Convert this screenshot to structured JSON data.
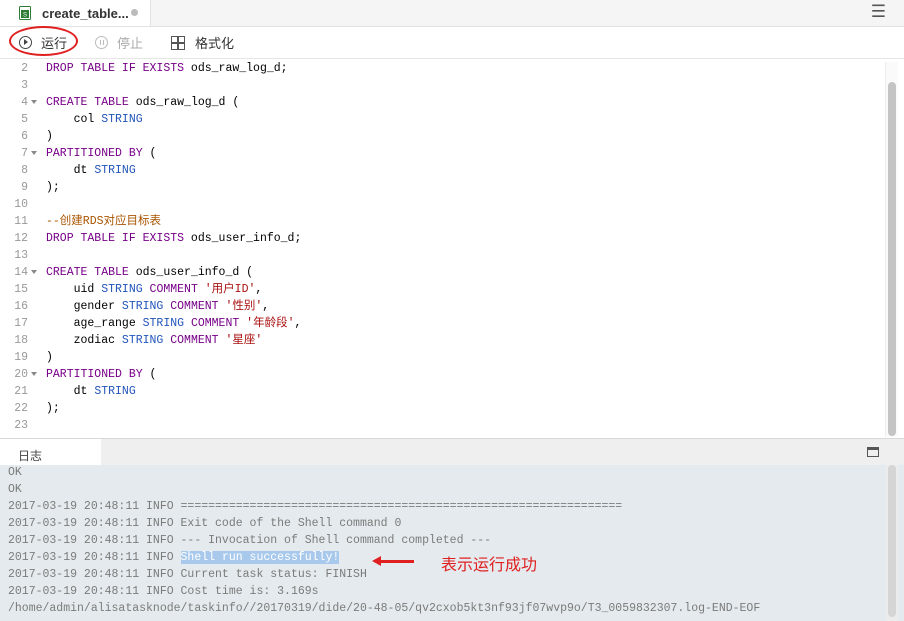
{
  "tab": {
    "title": "create_table..."
  },
  "toolbar": {
    "run_label": "运行",
    "stop_label": "停止",
    "format_label": "格式化"
  },
  "editor": {
    "lines": [
      {
        "n": "2",
        "fold": false,
        "tokens": [
          [
            "kw",
            "DROP TABLE IF EXISTS"
          ],
          [
            "",
            "ods_raw_log_d;"
          ]
        ]
      },
      {
        "n": "3",
        "fold": false,
        "tokens": []
      },
      {
        "n": "4",
        "fold": true,
        "tokens": [
          [
            "kw",
            "CREATE TABLE"
          ],
          [
            "",
            "ods_raw_log_d ("
          ]
        ]
      },
      {
        "n": "5",
        "fold": false,
        "tokens": [
          [
            "",
            "    col "
          ],
          [
            "ty",
            "STRING"
          ]
        ]
      },
      {
        "n": "6",
        "fold": false,
        "tokens": [
          [
            "",
            ")"
          ]
        ]
      },
      {
        "n": "7",
        "fold": true,
        "tokens": [
          [
            "kw",
            "PARTITIONED BY"
          ],
          [
            "",
            " ("
          ]
        ]
      },
      {
        "n": "8",
        "fold": false,
        "tokens": [
          [
            "",
            "    dt "
          ],
          [
            "ty",
            "STRING"
          ]
        ]
      },
      {
        "n": "9",
        "fold": false,
        "tokens": [
          [
            "",
            ");"
          ]
        ]
      },
      {
        "n": "10",
        "fold": false,
        "tokens": []
      },
      {
        "n": "11",
        "fold": false,
        "tokens": [
          [
            "cm",
            "--创建RDS对应目标表"
          ]
        ]
      },
      {
        "n": "12",
        "fold": false,
        "tokens": [
          [
            "kw",
            "DROP TABLE IF EXISTS"
          ],
          [
            "",
            " ods_user_info_d;"
          ]
        ]
      },
      {
        "n": "13",
        "fold": false,
        "tokens": []
      },
      {
        "n": "14",
        "fold": true,
        "tokens": [
          [
            "kw",
            "CREATE TABLE"
          ],
          [
            "",
            " ods_user_info_d ("
          ]
        ]
      },
      {
        "n": "15",
        "fold": false,
        "tokens": [
          [
            "",
            "    uid "
          ],
          [
            "ty",
            "STRING"
          ],
          [
            "",
            " "
          ],
          [
            "kw",
            "COMMENT"
          ],
          [
            "",
            " "
          ],
          [
            "str",
            "'用户ID'"
          ],
          [
            "",
            ","
          ]
        ]
      },
      {
        "n": "16",
        "fold": false,
        "tokens": [
          [
            "",
            "    gender "
          ],
          [
            "ty",
            "STRING"
          ],
          [
            "",
            " "
          ],
          [
            "kw",
            "COMMENT"
          ],
          [
            "",
            " "
          ],
          [
            "str",
            "'性别'"
          ],
          [
            "",
            ","
          ]
        ]
      },
      {
        "n": "17",
        "fold": false,
        "tokens": [
          [
            "",
            "    age_range "
          ],
          [
            "ty",
            "STRING"
          ],
          [
            "",
            " "
          ],
          [
            "kw",
            "COMMENT"
          ],
          [
            "",
            " "
          ],
          [
            "str",
            "'年龄段'"
          ],
          [
            "",
            ","
          ]
        ]
      },
      {
        "n": "18",
        "fold": false,
        "tokens": [
          [
            "",
            "    zodiac "
          ],
          [
            "ty",
            "STRING"
          ],
          [
            "",
            " "
          ],
          [
            "kw",
            "COMMENT"
          ],
          [
            "",
            " "
          ],
          [
            "str",
            "'星座'"
          ]
        ]
      },
      {
        "n": "19",
        "fold": false,
        "tokens": [
          [
            "",
            ")"
          ]
        ]
      },
      {
        "n": "20",
        "fold": true,
        "tokens": [
          [
            "kw",
            "PARTITIONED BY"
          ],
          [
            "",
            " ("
          ]
        ]
      },
      {
        "n": "21",
        "fold": false,
        "tokens": [
          [
            "",
            "    dt "
          ],
          [
            "ty",
            "STRING"
          ]
        ]
      },
      {
        "n": "22",
        "fold": false,
        "tokens": [
          [
            "",
            ");"
          ]
        ]
      },
      {
        "n": "23",
        "fold": false,
        "tokens": []
      }
    ]
  },
  "log": {
    "tab_label": "日志",
    "lines": [
      {
        "text": "OK"
      },
      {
        "text": "OK"
      },
      {
        "text": "2017-03-19 20:48:11 INFO ================================================================"
      },
      {
        "text": "2017-03-19 20:48:11 INFO Exit code of the Shell command 0"
      },
      {
        "text": "2017-03-19 20:48:11 INFO --- Invocation of Shell command completed ---"
      },
      {
        "prefix": "2017-03-19 20:48:11 INFO ",
        "highlight": "Shell run successfully!"
      },
      {
        "text": "2017-03-19 20:48:11 INFO Current task status: FINISH"
      },
      {
        "text": "2017-03-19 20:48:11 INFO Cost time is: 3.169s"
      },
      {
        "text": "/home/admin/alisatasknode/taskinfo//20170319/dide/20-48-05/qv2cxob5kt3nf93jf07wvp9o/T3_0059832307.log-END-EOF"
      }
    ]
  },
  "annotation": {
    "text": "表示运行成功"
  }
}
